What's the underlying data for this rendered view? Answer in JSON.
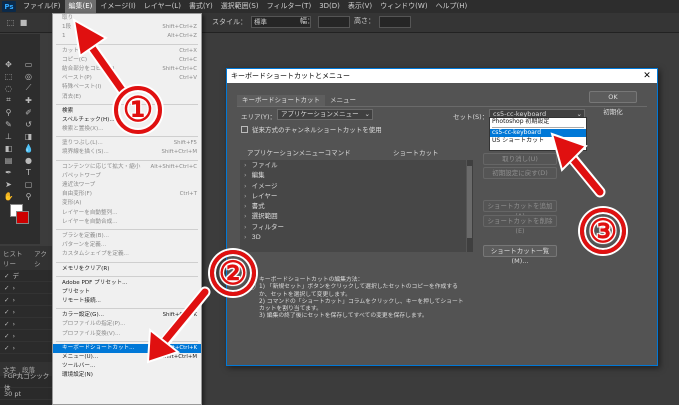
{
  "app": {
    "logo": "Ps"
  },
  "menubar": [
    "ファイル(F)",
    "編集(E)",
    "イメージ(I)",
    "レイヤー(L)",
    "書式(Y)",
    "選択範囲(S)",
    "フィルター(T)",
    "3D(D)",
    "表示(V)",
    "ウィンドウ(W)",
    "ヘルプ(H)"
  ],
  "options": {
    "style_label": "スタイル：",
    "style_value": "標準",
    "w_label": "幅：",
    "h_label": "高さ："
  },
  "left_panel": {
    "tab1": "ヒストリー",
    "tab2": "アクシ",
    "rows": [
      "デ",
      "",
      "",
      "",
      "",
      "",
      "",
      ""
    ],
    "text_tab1": "文字",
    "text_tab2": "段落",
    "font": "FGP丸ゴシック体",
    "size": "30 pt"
  },
  "edit_menu": [
    {
      "label": "取り",
      "sc": ""
    },
    {
      "label": "1段",
      "sc": "Shift+Ctrl+Z"
    },
    {
      "label": "1",
      "sc": "Alt+Ctrl+Z"
    },
    {
      "sep": true
    },
    {
      "label": "カット(T)",
      "sc": "Ctrl+X"
    },
    {
      "label": "コピー(C)",
      "sc": "Ctrl+C"
    },
    {
      "label": "結合部分をコピー(Y)",
      "sc": "Shift+Ctrl+C"
    },
    {
      "label": "ペースト(P)",
      "sc": "Ctrl+V"
    },
    {
      "label": "特殊ペースト(I)",
      "sc": ""
    },
    {
      "label": "消去(E)",
      "sc": ""
    },
    {
      "sep": true
    },
    {
      "label": "検索",
      "sc": "",
      "enabled": true
    },
    {
      "label": "スペルチェック(H)...",
      "sc": "",
      "enabled": true
    },
    {
      "label": "検索と置換(X)...",
      "sc": ""
    },
    {
      "sep": true
    },
    {
      "label": "塗りつぶし(L)...",
      "sc": "Shift+F5"
    },
    {
      "label": "境界線を描く(S)...",
      "sc": "Shift+Ctrl+M"
    },
    {
      "sep": true
    },
    {
      "label": "コンテンツに応じて拡大・縮小",
      "sc": "Alt+Shift+Ctrl+C"
    },
    {
      "label": "パペットワープ",
      "sc": ""
    },
    {
      "label": "遠近法ワープ",
      "sc": ""
    },
    {
      "label": "自由変形(F)",
      "sc": "Ctrl+T"
    },
    {
      "label": "変形(A)",
      "sc": ""
    },
    {
      "label": "レイヤーを自動整列...",
      "sc": ""
    },
    {
      "label": "レイヤーを自動合成...",
      "sc": ""
    },
    {
      "sep": true
    },
    {
      "label": "ブラシを定義(B)...",
      "sc": ""
    },
    {
      "label": "パターンを定義...",
      "sc": ""
    },
    {
      "label": "カスタムシェイプを定義...",
      "sc": ""
    },
    {
      "sep": true
    },
    {
      "label": "メモリをクリア(R)",
      "sc": "",
      "enabled": true
    },
    {
      "sep": true
    },
    {
      "label": "Adobe PDF プリセット...",
      "sc": "",
      "enabled": true
    },
    {
      "label": "プリセット",
      "sc": "",
      "enabled": true
    },
    {
      "label": "リモート接続...",
      "sc": "",
      "enabled": true
    },
    {
      "sep": true
    },
    {
      "label": "カラー設定(G)...",
      "sc": "Shift+Ctrl+K",
      "enabled": true
    },
    {
      "label": "プロファイルの指定(P)...",
      "sc": ""
    },
    {
      "label": "プロファイル変換(V)...",
      "sc": ""
    },
    {
      "sep": true
    },
    {
      "label": "キーボードショートカット...",
      "sc": "Alt+Shift+Ctrl+K",
      "highlight": true
    },
    {
      "label": "メニュー(U)...",
      "sc": "Alt+Shift+Ctrl+M",
      "enabled": true
    },
    {
      "label": "ツールバー...",
      "sc": "",
      "enabled": true
    },
    {
      "label": "環境設定(N)",
      "sc": "",
      "enabled": true
    }
  ],
  "dialog": {
    "title": "キーボードショートカットとメニュー",
    "close": "✕",
    "tab_shortcuts": "キーボードショートカット",
    "tab_menu": "メニュー",
    "area_label": "エリア(Y)：",
    "area_value": "アプリケーションメニュー",
    "set_label": "セット(S)：",
    "set_value": "cs5-cc-keyboard",
    "legacy_checkbox": "従来方式のチャンネルショートカットを使用",
    "col_command": "アプリケーションメニューコマンド",
    "col_shortcut": "ショートカット",
    "commands": [
      "ファイル",
      "編集",
      "イメージ",
      "レイヤー",
      "書式",
      "選択範囲",
      "フィルター",
      "3D"
    ],
    "set_options": [
      "Photoshop 初期設定",
      "cs5-cc-keyboard",
      "US ショートカット"
    ],
    "ok": "OK",
    "cancel": "初期化",
    "accept": "取り消し(U)",
    "use_default": "初期設定に戻す(D)",
    "add_shortcut": "ショートカットを追加(A)",
    "delete_shortcut": "ショートカットを削除(E)",
    "summarize": "ショートカット一覧(M)...",
    "instructions_title": "キーボードショートカットの編集方法：",
    "instructions": [
      "1) 「新規セット」ボタンをクリックして選択したセットのコピーを作成するか、セットを選択して変更します。",
      "2) コマンドの「ショートカット」コラムをクリックし、キーを押してショートカットを割り当てます。",
      "3) 編集の終了後にセットを保存してすべての変更を保存します。"
    ]
  },
  "annotations": [
    "①",
    "②",
    "③"
  ],
  "colors": {
    "accent": "#0078d7",
    "annotation": "#e01010"
  }
}
